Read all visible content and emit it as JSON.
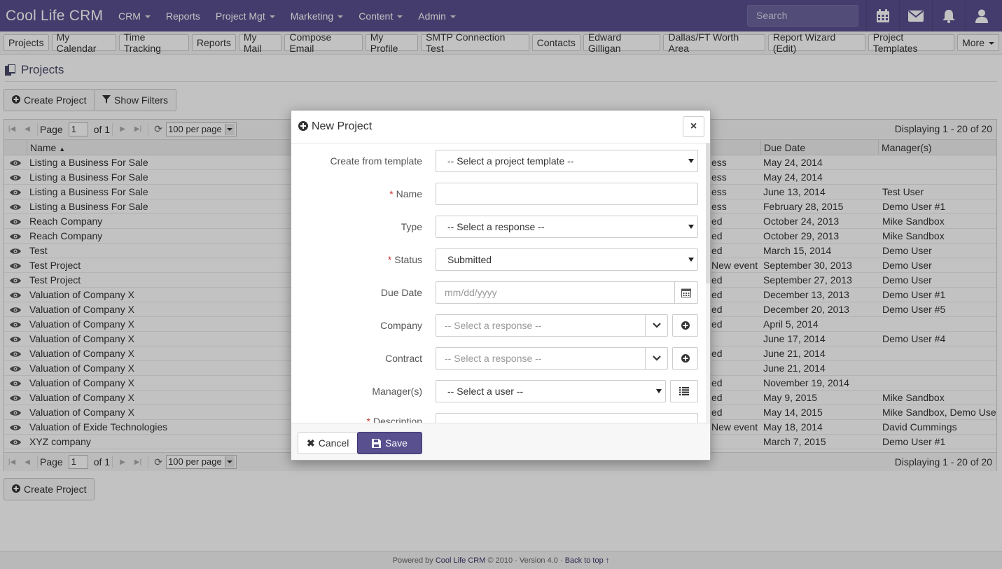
{
  "navbar": {
    "brand": "Cool Life CRM",
    "menu": [
      {
        "label": "CRM",
        "dropdown": true
      },
      {
        "label": "Reports",
        "dropdown": false
      },
      {
        "label": "Project Mgt",
        "dropdown": true
      },
      {
        "label": "Marketing",
        "dropdown": true
      },
      {
        "label": "Content",
        "dropdown": true
      },
      {
        "label": "Admin",
        "dropdown": true
      }
    ],
    "search_placeholder": "Search",
    "icons": [
      "calendar-icon",
      "envelope-icon",
      "bell-icon",
      "user-icon"
    ]
  },
  "tabs": [
    "Projects",
    "My Calendar",
    "Time Tracking",
    "Reports",
    "My Mail",
    "Compose Email",
    "My Profile",
    "SMTP Connection Test",
    "Contacts",
    "Edward Gilligan",
    "Dallas/FT Worth Area",
    "Report Wizard (Edit)",
    "Project Templates",
    "More"
  ],
  "page": {
    "title": "Projects",
    "create_label": "Create Project",
    "filters_label": "Show Filters"
  },
  "pager": {
    "page_label": "Page",
    "page_value": "1",
    "of_label": "of 1",
    "per_page": "100 per page",
    "display": "Displaying 1 - 20 of 20"
  },
  "grid": {
    "columns": {
      "name": "Name",
      "due": "Due Date",
      "managers": "Manager(s)"
    },
    "rows": [
      {
        "name": "Listing a Business For Sale",
        "status": "ess",
        "due": "May 24, 2014",
        "managers": ""
      },
      {
        "name": "Listing a Business For Sale",
        "status": "ess",
        "due": "May 24, 2014",
        "managers": ""
      },
      {
        "name": "Listing a Business For Sale",
        "status": "ess",
        "due": "June 13, 2014",
        "managers": "Test User"
      },
      {
        "name": "Listing a Business For Sale",
        "status": "ess",
        "due": "February 28, 2015",
        "managers": "Demo User #1"
      },
      {
        "name": "Reach Company",
        "status": "ed",
        "due": "October 24, 2013",
        "managers": "Mike Sandbox"
      },
      {
        "name": "Reach Company",
        "status": "ed",
        "due": "October 29, 2013",
        "managers": "Mike Sandbox"
      },
      {
        "name": "Test",
        "status": "ed",
        "due": "March 15, 2014",
        "managers": "Demo User"
      },
      {
        "name": "Test Project",
        "status": "New event",
        "due": "September 30, 2013",
        "managers": "Demo User"
      },
      {
        "name": "Test Project",
        "status": "ed",
        "due": "September 27, 2013",
        "managers": "Demo User"
      },
      {
        "name": "Valuation of Company X",
        "status": "ed",
        "due": "December 13, 2013",
        "managers": "Demo User #1"
      },
      {
        "name": "Valuation of Company X",
        "status": "ed",
        "due": "December 20, 2013",
        "managers": "Demo User #5"
      },
      {
        "name": "Valuation of Company X",
        "status": "ed",
        "due": "April 5, 2014",
        "managers": ""
      },
      {
        "name": "Valuation of Company X",
        "status": "",
        "due": "June 17, 2014",
        "managers": "Demo User #4"
      },
      {
        "name": "Valuation of Company X",
        "status": "ed",
        "due": "June 21, 2014",
        "managers": ""
      },
      {
        "name": "Valuation of Company X",
        "status": "",
        "due": "June 21, 2014",
        "managers": ""
      },
      {
        "name": "Valuation of Company X",
        "status": "ed",
        "due": "November 19, 2014",
        "managers": ""
      },
      {
        "name": "Valuation of Company X",
        "status": "ed",
        "due": "May 9, 2015",
        "managers": "Mike Sandbox"
      },
      {
        "name": "Valuation of Company X",
        "status": "ed",
        "due": "May 14, 2015",
        "managers": "Mike Sandbox, Demo User"
      },
      {
        "name": "Valuation of Exide Technologies",
        "status": "New event",
        "due": "May 18, 2014",
        "managers": "David Cummings"
      },
      {
        "name": "XYZ company",
        "status": "",
        "due": "March 7, 2015",
        "managers": "Demo User #1"
      }
    ]
  },
  "modal": {
    "title": "New Project",
    "close_label": "×",
    "fields": {
      "template": {
        "label": "Create from template",
        "value": "-- Select a project template --"
      },
      "name": {
        "label": "Name",
        "value": ""
      },
      "type": {
        "label": "Type",
        "value": "-- Select a response --"
      },
      "status": {
        "label": "Status",
        "value": "Submitted"
      },
      "due": {
        "label": "Due Date",
        "placeholder": "mm/dd/yyyy"
      },
      "company": {
        "label": "Company",
        "placeholder": "-- Select a response --"
      },
      "contract": {
        "label": "Contract",
        "placeholder": "-- Select a response --"
      },
      "managers": {
        "label": "Manager(s)",
        "value": "-- Select a user --"
      },
      "description": {
        "label": "Description"
      }
    },
    "cancel_label": "Cancel",
    "save_label": "Save"
  },
  "footer": {
    "prefix": "Powered by",
    "brand": "Cool Life CRM",
    "rest": "© 2010 · Version 4.0 ·",
    "top_link": "Back to top ↑"
  },
  "colors": {
    "brand": "#58508f"
  }
}
